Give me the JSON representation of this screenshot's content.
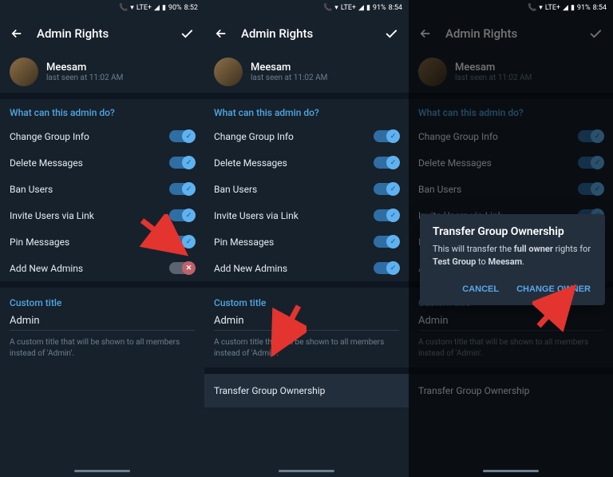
{
  "status": {
    "battery1": "90%",
    "time1": "8:52",
    "battery2": "91%",
    "time2": "8:54",
    "battery3": "91%",
    "time3": "8:54",
    "lte": "LTE+"
  },
  "header": {
    "title": "Admin Rights"
  },
  "user": {
    "name": "Meesam",
    "status": "last seen at 11:02 AM"
  },
  "sections": {
    "what_can": "What can this admin do?",
    "custom_title": "Custom title"
  },
  "perms": {
    "change_group_info": "Change Group Info",
    "delete_messages": "Delete Messages",
    "ban_users": "Ban Users",
    "invite_users": "Invite Users via Link",
    "pin_messages": "Pin Messages",
    "add_admins": "Add New Admins"
  },
  "custom": {
    "value": "Admin",
    "hint": "A custom title that will be shown to all members instead of 'Admin'."
  },
  "actions": {
    "transfer": "Transfer Group Ownership"
  },
  "dialog": {
    "title": "Transfer Group Ownership",
    "pre": "This will transfer the ",
    "bold1": "full owner",
    "mid": " rights for ",
    "bold2": "Test Group",
    "to": " to ",
    "bold3": "Meesam",
    "end": ".",
    "cancel": "CANCEL",
    "confirm": "CHANGE OWNER"
  }
}
